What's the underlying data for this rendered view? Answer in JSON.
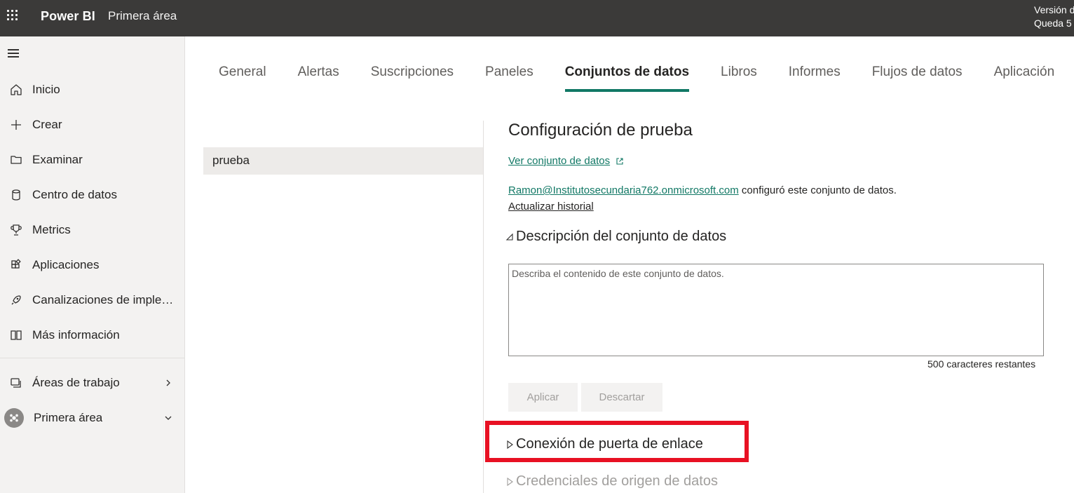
{
  "header": {
    "brand": "Power BI",
    "workspace": "Primera área",
    "trial_line1": "Versión de",
    "trial_line2": "Queda 5"
  },
  "nav": {
    "items": [
      {
        "label": "Inicio",
        "icon": "home-icon"
      },
      {
        "label": "Crear",
        "icon": "plus-icon"
      },
      {
        "label": "Examinar",
        "icon": "folder-icon"
      },
      {
        "label": "Centro de datos",
        "icon": "database-icon"
      },
      {
        "label": "Metrics",
        "icon": "trophy-icon"
      },
      {
        "label": "Aplicaciones",
        "icon": "apps-icon"
      },
      {
        "label": "Canalizaciones de implementación",
        "icon": "rocket-icon"
      },
      {
        "label": "Más información",
        "icon": "book-icon"
      }
    ],
    "workspaces_label": "Áreas de trabajo",
    "current_workspace_label": "Primera área"
  },
  "tabs": [
    {
      "label": "General",
      "active": false
    },
    {
      "label": "Alertas",
      "active": false
    },
    {
      "label": "Suscripciones",
      "active": false
    },
    {
      "label": "Paneles",
      "active": false
    },
    {
      "label": "Conjuntos de datos",
      "active": true
    },
    {
      "label": "Libros",
      "active": false
    },
    {
      "label": "Informes",
      "active": false
    },
    {
      "label": "Flujos de datos",
      "active": false
    },
    {
      "label": "Aplicación",
      "active": false
    }
  ],
  "datasets": {
    "selected": "prueba"
  },
  "settings": {
    "title": "Configuración de prueba",
    "view_dataset_link": "Ver conjunto de datos",
    "owner_email": "Ramon@Institutosecundaria762.onmicrosoft.com",
    "configured_text": " configuró este conjunto de datos.",
    "refresh_history": "Actualizar historial",
    "description_section": "Descripción del conjunto de datos",
    "description_placeholder": "Describa el contenido de este conjunto de datos.",
    "description_value": "",
    "chars_remaining": "500 caracteres restantes",
    "apply_label": "Aplicar",
    "discard_label": "Descartar",
    "gateway_section": "Conexión de puerta de enlace",
    "credentials_section": "Credenciales de origen de datos"
  },
  "colors": {
    "accent": "#117865",
    "header_bg": "#3b3a39",
    "highlight": "#e81123"
  }
}
